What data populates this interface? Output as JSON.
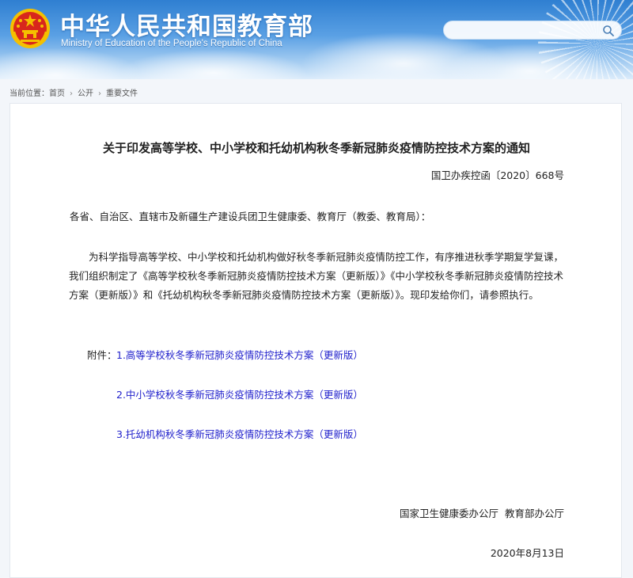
{
  "header": {
    "title": "中华人民共和国教育部",
    "subtitle": "Ministry of Education of the People's Republic of China",
    "colors": {
      "sky_top": "#2f7fd1",
      "sky_bottom": "#dcecfb",
      "emblem_red": "#d8271c",
      "emblem_gold": "#f5c000"
    }
  },
  "search": {
    "value": "",
    "placeholder": "",
    "icon": "search-icon"
  },
  "breadcrumb": {
    "prefix": "当前位置：",
    "items": [
      "首页",
      "公开",
      "重要文件"
    ],
    "separator": "›"
  },
  "document": {
    "title": "关于印发高等学校、中小学校和托幼机构秋冬季新冠肺炎疫情防控技术方案的通知",
    "number": "国卫办疾控函〔2020〕668号",
    "salutation": "各省、自治区、直辖市及新疆生产建设兵团卫生健康委、教育厅（教委、教育局）：",
    "body": "为科学指导高等学校、中小学校和托幼机构做好秋冬季新冠肺炎疫情防控工作，有序推进秋季学期复学复课，我们组织制定了《高等学校秋冬季新冠肺炎疫情防控技术方案（更新版）》《中小学校秋冬季新冠肺炎疫情防控技术方案（更新版）》和《托幼机构秋冬季新冠肺炎疫情防控技术方案（更新版）》。现印发给你们，请参照执行。",
    "attachments_label": "附件：",
    "attachments": [
      "1.高等学校秋冬季新冠肺炎疫情防控技术方案（更新版）",
      "2.中小学校秋冬季新冠肺炎疫情防控技术方案（更新版）",
      "3.托幼机构秋冬季新冠肺炎疫情防控技术方案（更新版）"
    ],
    "link_color": "#2222cc",
    "signer": "国家卫生健康委办公厅  教育部办公厅",
    "date": "2020年8月13日"
  }
}
